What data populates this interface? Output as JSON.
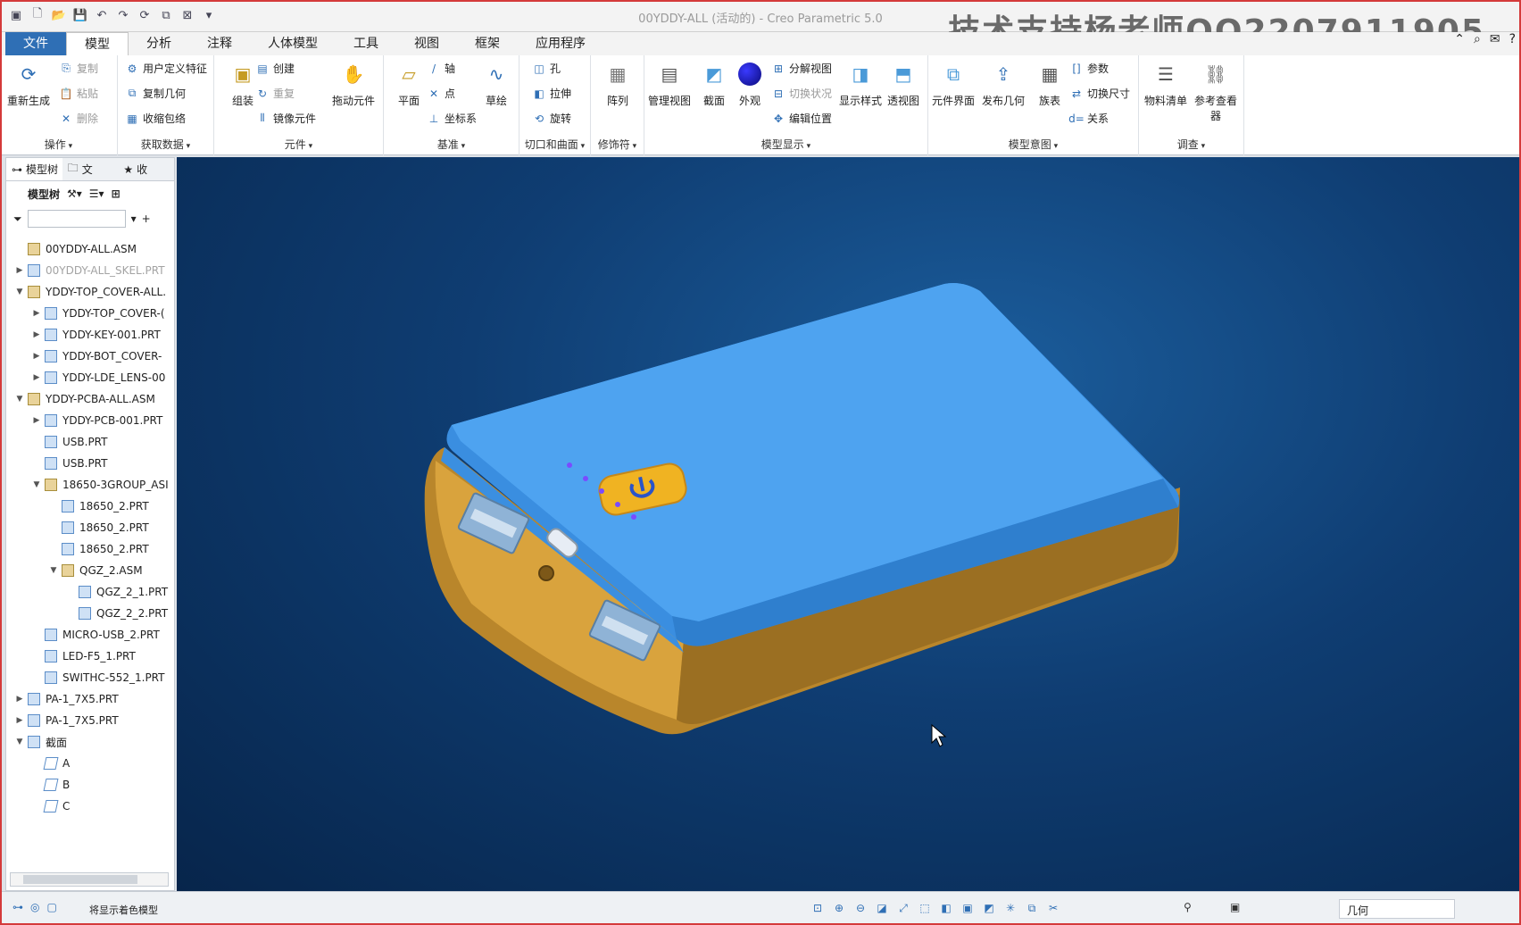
{
  "title": "00YDDY-ALL (活动的) - Creo Parametric 5.0",
  "watermark": "技术支持杨老师QQ2207911905",
  "tabs": [
    "文件",
    "模型",
    "分析",
    "注释",
    "人体模型",
    "工具",
    "视图",
    "框架",
    "应用程序"
  ],
  "ribbon": {
    "ops": {
      "title": "操作",
      "regen": "重新生成",
      "copy": "复制",
      "paste": "粘贴",
      "delete": "删除"
    },
    "data": {
      "title": "获取数据",
      "udf": "用户定义特征",
      "copygeom": "复制几何",
      "shrinkwrap": "收缩包络"
    },
    "comp": {
      "title": "元件",
      "assemble": "组装",
      "create": "创建",
      "repeat": "重复",
      "mirror": "镜像元件",
      "drag": "拖动元件"
    },
    "datum": {
      "title": "基准",
      "plane": "平面",
      "axis": "轴",
      "point": "点",
      "csys": "坐标系",
      "sketch": "草绘"
    },
    "cut": {
      "title": "切口和曲面",
      "hole": "孔",
      "extrude": "拉伸",
      "revolve": "旋转"
    },
    "mod": {
      "title": "修饰符",
      "pattern": "阵列"
    },
    "display": {
      "title": "模型显示",
      "manage": "管理视图",
      "section": "截面",
      "appearance": "外观",
      "explode": "分解视图",
      "toggle": "切换状况",
      "editpos": "编辑位置",
      "style": "显示样式",
      "persp": "透视图"
    },
    "intent": {
      "title": "模型意图",
      "interface": "元件界面",
      "publish": "发布几何",
      "family": "族表",
      "params": "参数",
      "switchdim": "切换尺寸",
      "relations": "关系"
    },
    "investigate": {
      "title": "调查",
      "bom": "物料清单",
      "refviewer": "参考查看器"
    }
  },
  "sidebar": {
    "tab_tree": "模型树",
    "tab_folder": "文",
    "tab_fav": "收",
    "bar_label": "模型树",
    "tree": [
      {
        "label": "00YDDY-ALL.ASM",
        "indent": 0,
        "twisty": "",
        "kind": "asm",
        "dim": false
      },
      {
        "label": "00YDDY-ALL_SKEL.PRT",
        "indent": 0,
        "twisty": "▶",
        "kind": "prt",
        "dim": true
      },
      {
        "label": "YDDY-TOP_COVER-ALL.",
        "indent": 0,
        "twisty": "▼",
        "kind": "asm",
        "dim": false
      },
      {
        "label": "YDDY-TOP_COVER-(",
        "indent": 1,
        "twisty": "▶",
        "kind": "prt",
        "dim": false
      },
      {
        "label": "YDDY-KEY-001.PRT",
        "indent": 1,
        "twisty": "▶",
        "kind": "prt",
        "dim": false
      },
      {
        "label": "YDDY-BOT_COVER-",
        "indent": 1,
        "twisty": "▶",
        "kind": "prt",
        "dim": false
      },
      {
        "label": "YDDY-LDE_LENS-00",
        "indent": 1,
        "twisty": "▶",
        "kind": "prt",
        "dim": false
      },
      {
        "label": "YDDY-PCBA-ALL.ASM",
        "indent": 0,
        "twisty": "▼",
        "kind": "asm",
        "dim": false
      },
      {
        "label": "YDDY-PCB-001.PRT",
        "indent": 1,
        "twisty": "▶",
        "kind": "prt",
        "dim": false
      },
      {
        "label": "USB.PRT",
        "indent": 1,
        "twisty": "",
        "kind": "prt",
        "dim": false
      },
      {
        "label": "USB.PRT",
        "indent": 1,
        "twisty": "",
        "kind": "prt",
        "dim": false
      },
      {
        "label": "18650-3GROUP_ASI",
        "indent": 1,
        "twisty": "▼",
        "kind": "asm",
        "dim": false
      },
      {
        "label": "18650_2.PRT",
        "indent": 2,
        "twisty": "",
        "kind": "prt",
        "dim": false
      },
      {
        "label": "18650_2.PRT",
        "indent": 2,
        "twisty": "",
        "kind": "prt",
        "dim": false
      },
      {
        "label": "18650_2.PRT",
        "indent": 2,
        "twisty": "",
        "kind": "prt",
        "dim": false
      },
      {
        "label": "QGZ_2.ASM",
        "indent": 2,
        "twisty": "▼",
        "kind": "asm",
        "dim": false
      },
      {
        "label": "QGZ_2_1.PRT",
        "indent": 3,
        "twisty": "",
        "kind": "prt",
        "dim": false
      },
      {
        "label": "QGZ_2_2.PRT",
        "indent": 3,
        "twisty": "",
        "kind": "prt",
        "dim": false
      },
      {
        "label": "MICRO-USB_2.PRT",
        "indent": 1,
        "twisty": "",
        "kind": "prt",
        "dim": false
      },
      {
        "label": "LED-F5_1.PRT",
        "indent": 1,
        "twisty": "",
        "kind": "prt",
        "dim": false
      },
      {
        "label": "SWITHC-552_1.PRT",
        "indent": 1,
        "twisty": "",
        "kind": "prt",
        "dim": false
      },
      {
        "label": "PA-1_7X5.PRT",
        "indent": 0,
        "twisty": "▶",
        "kind": "prt",
        "dim": false
      },
      {
        "label": "PA-1_7X5.PRT",
        "indent": 0,
        "twisty": "▶",
        "kind": "prt",
        "dim": false
      },
      {
        "label": "截面",
        "indent": 0,
        "twisty": "▼",
        "kind": "prt",
        "dim": false
      },
      {
        "label": "A",
        "indent": 1,
        "twisty": "",
        "kind": "sec",
        "dim": false
      },
      {
        "label": "B",
        "indent": 1,
        "twisty": "",
        "kind": "sec",
        "dim": false
      },
      {
        "label": "C",
        "indent": 1,
        "twisty": "",
        "kind": "sec",
        "dim": false
      }
    ]
  },
  "status": {
    "message": "将显示着色模型",
    "filter": "几何"
  }
}
